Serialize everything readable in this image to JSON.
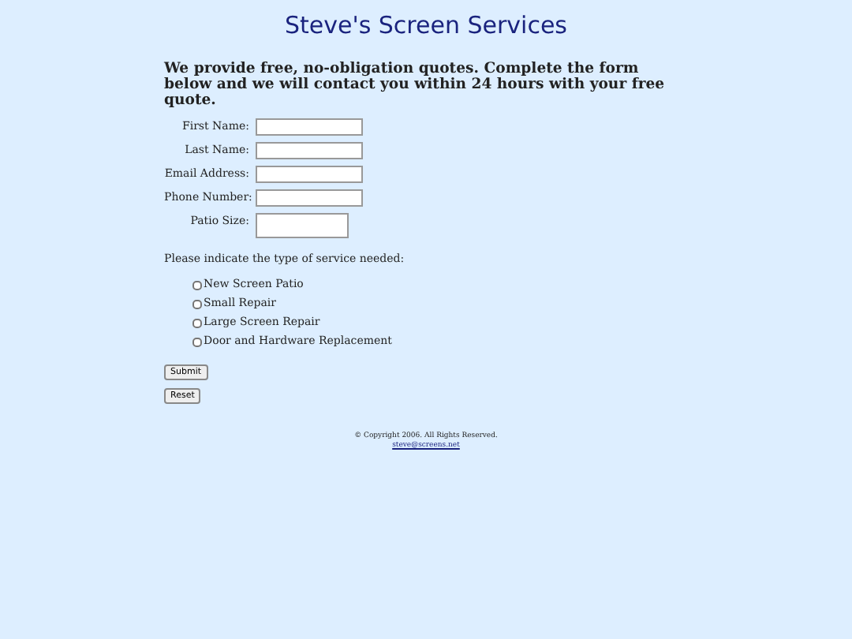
{
  "header": {
    "title": "Steve's Screen Services"
  },
  "intro": "We provide free, no-obligation quotes. Complete the form below and we will contact you within 24 hours with your free quote.",
  "fields": [
    {
      "label": "First Name:",
      "kind": "text"
    },
    {
      "label": "Last Name:",
      "kind": "text"
    },
    {
      "label": "Email Address:",
      "kind": "text"
    },
    {
      "label": "Phone Number:",
      "kind": "text"
    },
    {
      "label": "Patio Size:",
      "kind": "textarea"
    }
  ],
  "services_prompt": "Please indicate the type of service needed:",
  "services": [
    {
      "label": "New Screen Patio",
      "checked": false
    },
    {
      "label": "Small Repair",
      "checked": false
    },
    {
      "label": "Large Screen Repair",
      "checked": false
    },
    {
      "label": "Door and Hardware Replacement",
      "checked": false
    }
  ],
  "buttons": [
    "Submit",
    "Reset"
  ],
  "footer": {
    "copyright": "© Copyright 2006. All Rights Reserved.",
    "email": "steve@screens.net"
  }
}
